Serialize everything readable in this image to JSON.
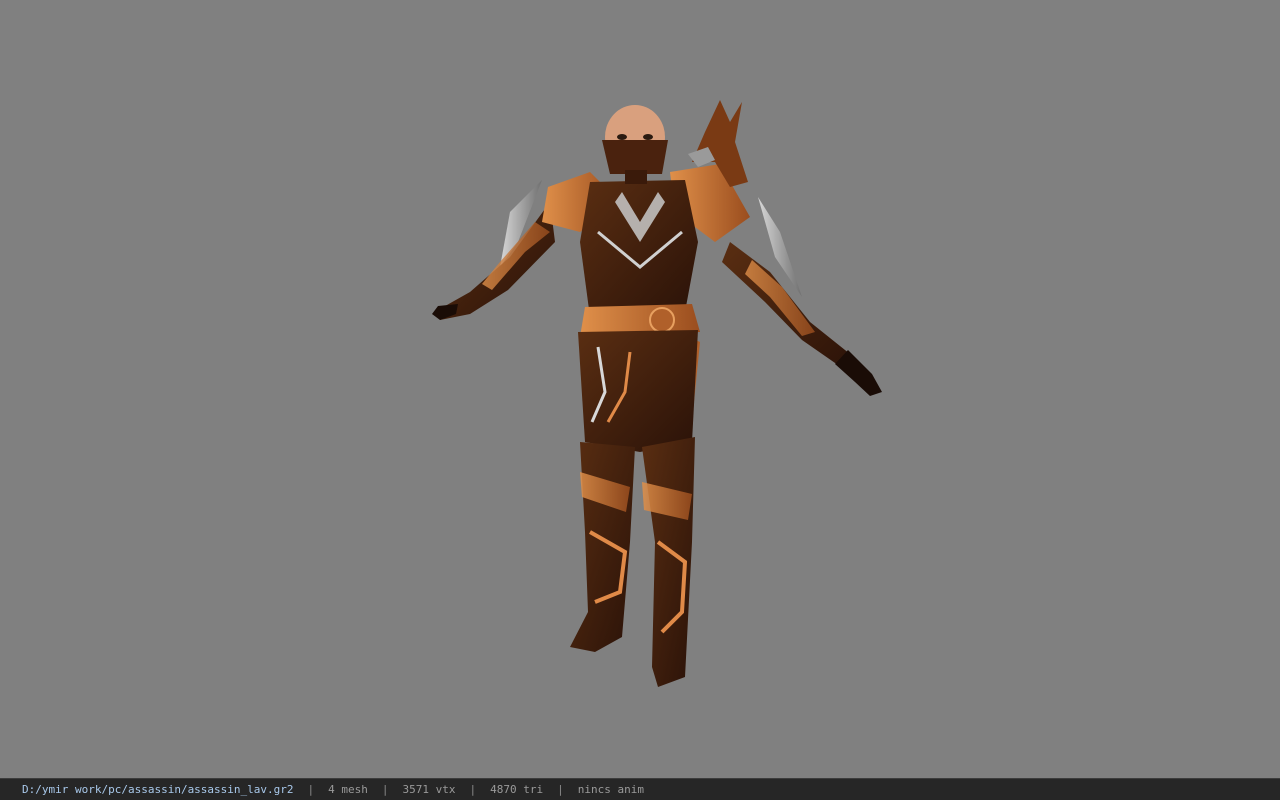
{
  "viewport": {
    "background_color": "#808080",
    "model_description_icon": "3d-character-model"
  },
  "status": {
    "file_path": "D:/ymir work/pc/assassin/assassin_lav.gr2",
    "mesh": "4 mesh",
    "vertices": "3571 vtx",
    "triangles": "4870 tri",
    "animation": "nincs anim",
    "separator": "|"
  },
  "colors": {
    "statusbar_bg": "#262626",
    "path_text": "#a8c8ea",
    "info_text": "#9a9a9a",
    "armor_dark": "#3a1d0c",
    "armor_trim": "#c8733a",
    "skin": "#d9a07e"
  }
}
